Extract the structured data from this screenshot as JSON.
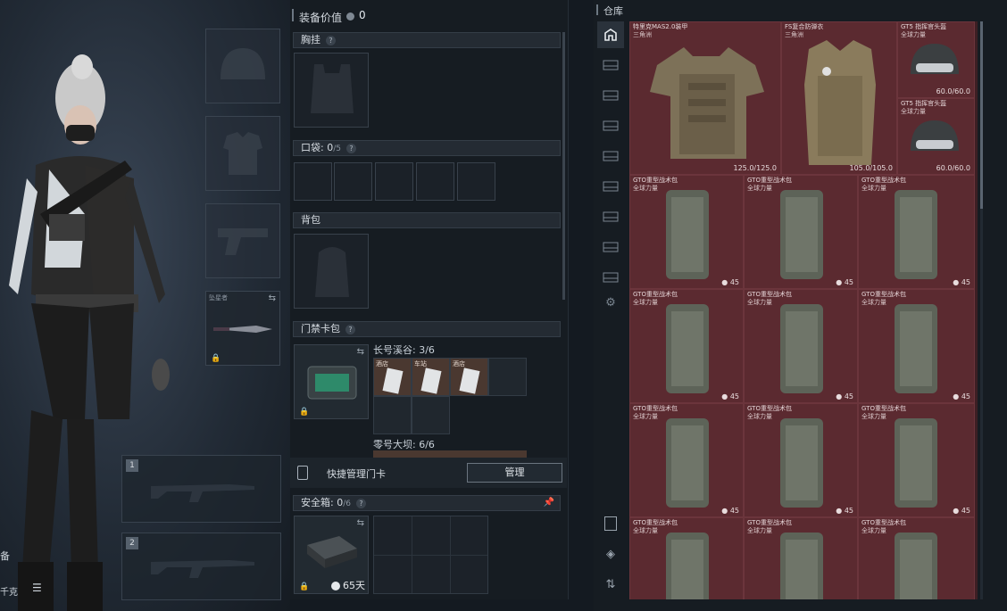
{
  "equipment": {
    "header_label": "装备价值",
    "header_value": "0",
    "sections": {
      "chest_rig": "胸挂",
      "pockets_label": "口袋:",
      "pockets_used": "0",
      "pockets_total": "/5",
      "backpack": "背包",
      "keycard": "门禁卡包",
      "secure_case_label": "安全箱:",
      "secure_case_used": "0",
      "secure_case_total": "/6"
    },
    "melee_slot_label": "坠星者",
    "keycard_groups": [
      {
        "label": "长号溪谷: 3/6",
        "cards": [
          "酒店",
          "车站",
          "酒店"
        ]
      },
      {
        "label": "零号大坝: 6/6"
      }
    ],
    "quick_manage_label": "快捷管理门卡",
    "manage_button": "管理",
    "secure_case_timer": "65天"
  },
  "character": {
    "weapon_slots": [
      "1",
      "2"
    ],
    "side_text_1": "备",
    "side_text_2": "千克"
  },
  "warehouse": {
    "title": "仓库",
    "items": [
      {
        "name": "特里克MAS2.0装甲",
        "sub": "三角洲",
        "value": "125.0/125.0"
      },
      {
        "name": "FS复合防弹衣",
        "sub": "三角洲",
        "value": "105.0/105.0"
      },
      {
        "name": "GT5 指挥官头盔",
        "sub": "全球力量",
        "value": "60.0/60.0"
      },
      {
        "name": "GT5 指挥官头盔",
        "sub": "全球力量",
        "value": "60.0/60.0"
      }
    ],
    "bag_name": "GTO重型战术包",
    "bag_sub": "全球力量",
    "bag_count": "45"
  },
  "colors": {
    "storage_bg": "#3d1f24",
    "tile_bg": "#5b2a30",
    "panel_bg": "#161c22"
  }
}
